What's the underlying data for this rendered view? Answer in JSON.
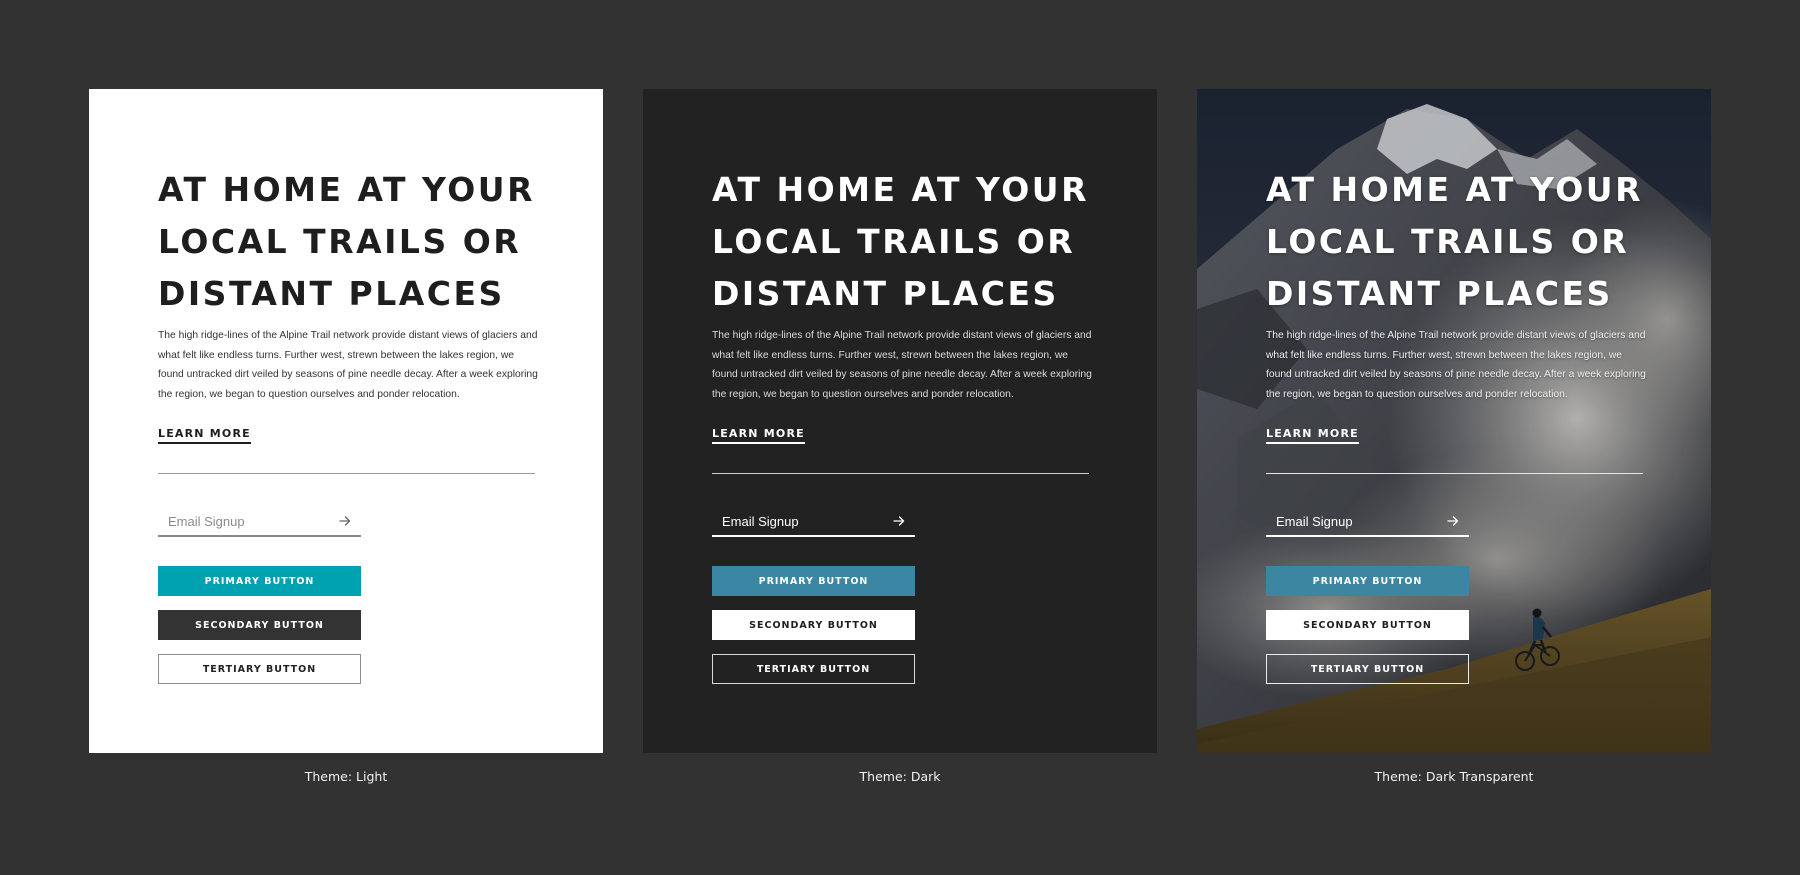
{
  "headline": "AT HOME AT YOUR LOCAL TRAILS OR DISTANT PLACES",
  "body": "The high ridge-lines of the Alpine Trail network provide distant views of glaciers and what felt like endless turns. Further west, strewn between the lakes region, we found untracked dirt veiled by seasons of pine needle decay. After a week exploring the region, we began to question ourselves and ponder relocation.",
  "learn_more": "LEARN MORE",
  "email": {
    "placeholder": "Email Signup",
    "submit_icon": "arrow-right-icon"
  },
  "buttons": {
    "primary": "PRIMARY BUTTON",
    "secondary": "SECONDARY BUTTON",
    "tertiary": "TERTIARY BUTTON"
  },
  "themes": [
    {
      "caption": "Theme: Light",
      "background": "#ffffff",
      "primary_color": "#00a1b0"
    },
    {
      "caption": "Theme: Dark",
      "background": "#222222",
      "primary_color": "#3a86a3"
    },
    {
      "caption": "Theme: Dark Transparent",
      "background": "mountain-cyclist-photo",
      "primary_color": "#3d86a1"
    }
  ],
  "page_background": "#323232"
}
